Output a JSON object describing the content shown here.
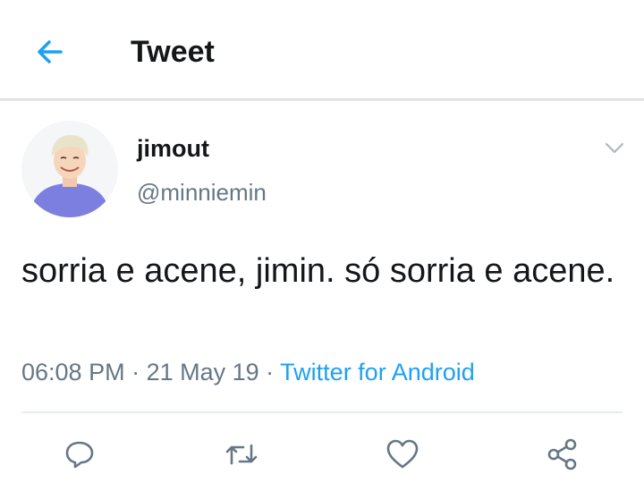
{
  "header": {
    "title": "Tweet",
    "back_icon": "back-arrow-icon"
  },
  "tweet": {
    "author": {
      "display_name": "jimout",
      "handle": "@minniemin",
      "avatar_icon": "avatar-photo"
    },
    "text": "sorria e acene, jimin. só sorria e acene.",
    "meta": {
      "time": "06:08 PM",
      "separator1": " · ",
      "date": "21 May 19",
      "separator2": " · ",
      "source": "Twitter for Android"
    }
  },
  "actions": {
    "reply_icon": "reply-icon",
    "retweet_icon": "retweet-icon",
    "like_icon": "heart-icon",
    "share_icon": "share-icon"
  },
  "colors": {
    "accent": "#1da1f2",
    "text": "#14171a",
    "secondary_text": "#657786",
    "icon": "#657786"
  }
}
